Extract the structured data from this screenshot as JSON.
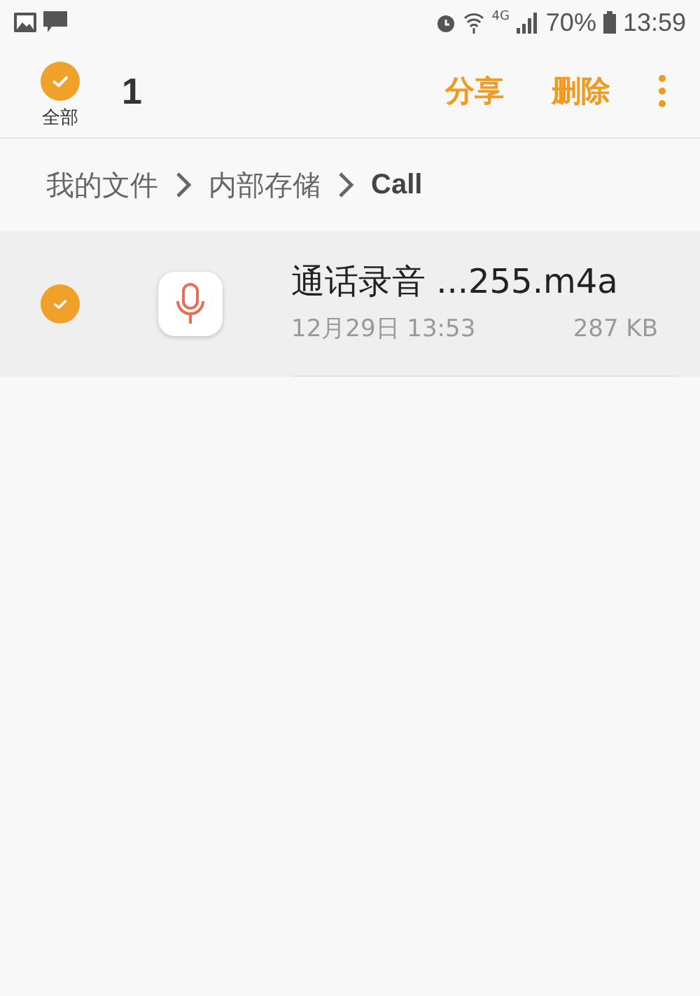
{
  "status_bar": {
    "network": "4G",
    "battery": "70%",
    "time": "13:59"
  },
  "header": {
    "select_all": {
      "label": "全部",
      "checked": true
    },
    "count": "1",
    "actions": [
      "分享",
      "删除"
    ]
  },
  "breadcrumb": [
    {
      "label": "我的文件",
      "current": false
    },
    {
      "label": "内部存储",
      "current": false
    },
    {
      "label": "Call",
      "current": true
    }
  ],
  "files": [
    {
      "name": "通话录音 ...255.m4a",
      "date": "12月29日 13:53",
      "size": "287 KB",
      "selected": true
    }
  ]
}
